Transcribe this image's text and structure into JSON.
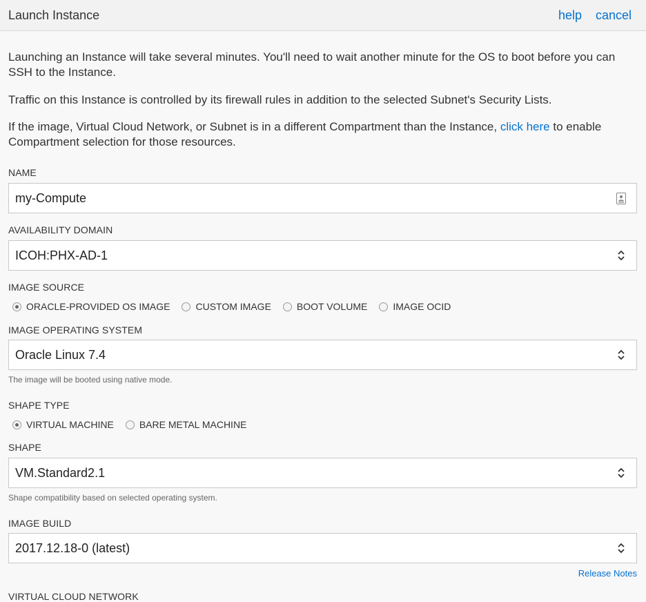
{
  "header": {
    "title": "Launch Instance",
    "help_label": "help",
    "cancel_label": "cancel"
  },
  "intro": {
    "p1": "Launching an Instance will take several minutes. You'll need to wait another minute for the OS to boot before you can SSH to the Instance.",
    "p2": "Traffic on this Instance is controlled by its firewall rules in addition to the selected Subnet's Security Lists.",
    "p3_before": "If the image, Virtual Cloud Network, or Subnet is in a different Compartment than the Instance, ",
    "p3_link": "click here",
    "p3_after": " to enable Compartment selection for those resources."
  },
  "form": {
    "name": {
      "label": "NAME",
      "value": "my-Compute"
    },
    "availability_domain": {
      "label": "AVAILABILITY DOMAIN",
      "value": "ICOH:PHX-AD-1"
    },
    "image_source": {
      "label": "IMAGE SOURCE",
      "options": [
        "ORACLE-PROVIDED OS IMAGE",
        "CUSTOM IMAGE",
        "BOOT VOLUME",
        "IMAGE OCID"
      ],
      "selected": "ORACLE-PROVIDED OS IMAGE"
    },
    "image_os": {
      "label": "IMAGE OPERATING SYSTEM",
      "value": "Oracle Linux 7.4",
      "hint": "The image will be booted using native mode."
    },
    "shape_type": {
      "label": "SHAPE TYPE",
      "options": [
        "VIRTUAL MACHINE",
        "BARE METAL MACHINE"
      ],
      "selected": "VIRTUAL MACHINE"
    },
    "shape": {
      "label": "SHAPE",
      "value": "VM.Standard2.1",
      "hint": "Shape compatibility based on selected operating system."
    },
    "image_build": {
      "label": "IMAGE BUILD",
      "value": "2017.12.18-0 (latest)",
      "release_notes": "Release Notes"
    },
    "vcn": {
      "label": "VIRTUAL CLOUD NETWORK"
    }
  },
  "colors": {
    "link": "#0572ce",
    "header_bg": "#f2f2f2",
    "body_bg": "#f8f8f8"
  }
}
